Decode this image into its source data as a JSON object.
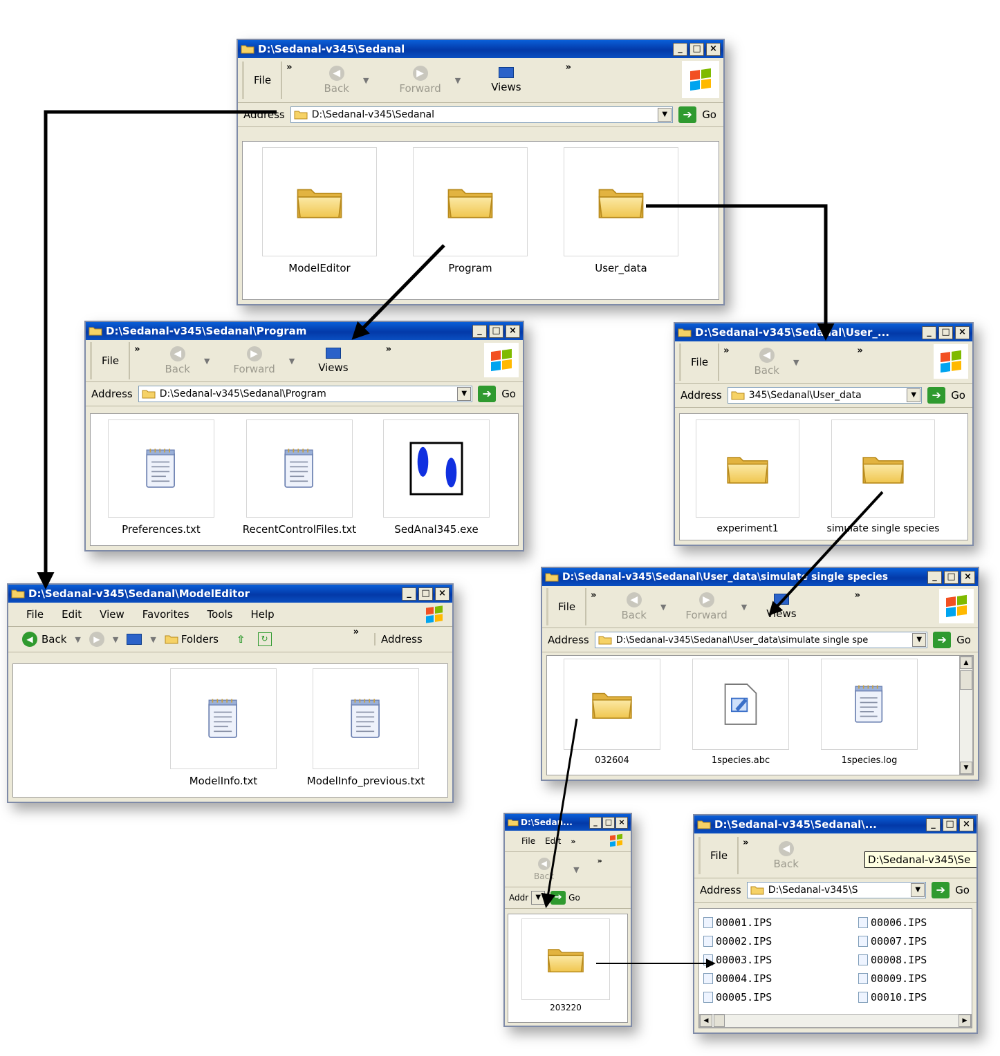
{
  "colors": {
    "title_bar": "#0a4fc0",
    "folder": "#f5d36b",
    "window_face": "#ece9d8",
    "arrow": "#000000"
  },
  "common": {
    "file": "File",
    "back": "Back",
    "forward": "Forward",
    "views": "Views",
    "address": "Address",
    "go": "Go",
    "chevron": "»"
  },
  "win_sedanal": {
    "title": "D:\\Sedanal-v345\\Sedanal",
    "address": "D:\\Sedanal-v345\\Sedanal",
    "items": [
      "ModelEditor",
      "Program",
      "User_data"
    ]
  },
  "win_program": {
    "title": "D:\\Sedanal-v345\\Sedanal\\Program",
    "address": "D:\\Sedanal-v345\\Sedanal\\Program",
    "items": [
      "Preferences.txt",
      "RecentControlFiles.txt",
      "SedAnal345.exe"
    ]
  },
  "win_userdata": {
    "title": "D:\\Sedanal-v345\\Sedanal\\User_...",
    "address": "345\\Sedanal\\User_data",
    "items": [
      "experiment1",
      "simulate single species"
    ]
  },
  "win_modeleditor": {
    "title": "D:\\Sedanal-v345\\Sedanal\\ModelEditor",
    "menu": [
      "File",
      "Edit",
      "View",
      "Favorites",
      "Tools",
      "Help"
    ],
    "folders": "Folders",
    "items": [
      "ModelInfo.txt",
      "ModelInfo_previous.txt"
    ]
  },
  "win_simulate": {
    "title": "D:\\Sedanal-v345\\Sedanal\\User_data\\simulate single species",
    "address": "D:\\Sedanal-v345\\Sedanal\\User_data\\simulate single spe",
    "items": [
      "032604",
      "1species.abc",
      "1species.log"
    ]
  },
  "win_small": {
    "title": "D:\\Sedan...",
    "file": "File",
    "edit": "Edit",
    "address": "Addr",
    "items": [
      "203220"
    ]
  },
  "win_ips": {
    "title": "D:\\Sedanal-v345\\Sedanal\\...",
    "address": "D:\\Sedanal-v345\\S",
    "tooltip": "D:\\Sedanal-v345\\Se",
    "files_left": [
      "00001.IPS",
      "00002.IPS",
      "00003.IPS",
      "00004.IPS",
      "00005.IPS"
    ],
    "files_right": [
      "00006.IPS",
      "00007.IPS",
      "00008.IPS",
      "00009.IPS",
      "00010.IPS"
    ]
  }
}
